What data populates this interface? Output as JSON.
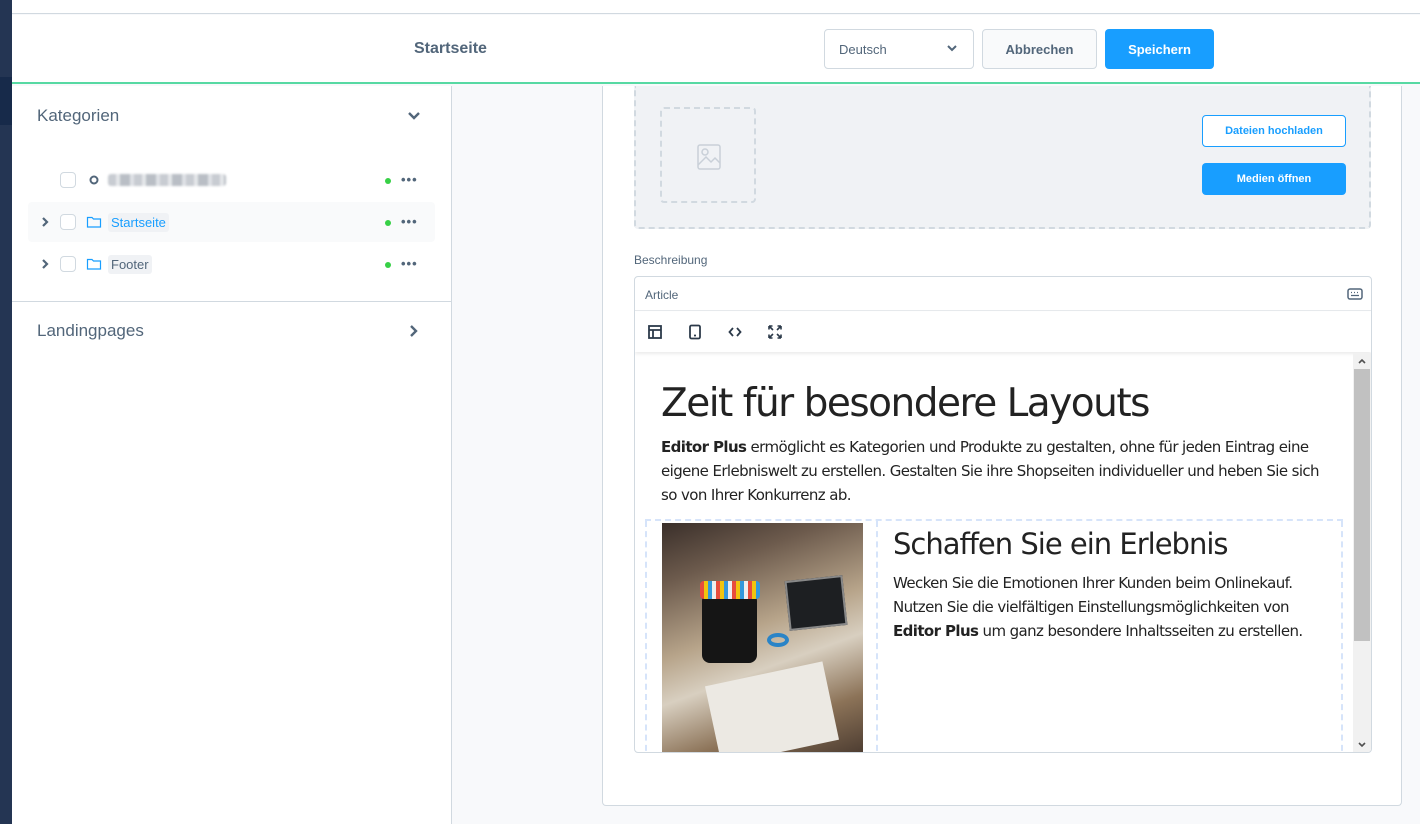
{
  "header": {
    "title": "Startseite",
    "language_select": {
      "value": "Deutsch"
    },
    "cancel_label": "Abbrechen",
    "save_label": "Speichern"
  },
  "sidebar": {
    "sections": [
      {
        "label": "Kategorien",
        "expanded": true
      },
      {
        "label": "Landingpages",
        "expanded": false
      }
    ],
    "tree": [
      {
        "label": "[redacted]",
        "icon": "circle-icon",
        "has_children": false,
        "active": false,
        "status": "active"
      },
      {
        "label": "Startseite",
        "icon": "folder-icon",
        "has_children": true,
        "active": true,
        "status": "active"
      },
      {
        "label": "Footer",
        "icon": "folder-icon",
        "has_children": true,
        "active": false,
        "status": "active"
      }
    ],
    "more_label": "•••"
  },
  "media": {
    "upload_label": "Dateien hochladen",
    "open_media_label": "Medien öffnen"
  },
  "description": {
    "label": "Beschreibung",
    "editor": {
      "mode_label": "Article",
      "toolbar": [
        "layout-icon",
        "mobile-preview-icon",
        "code-icon",
        "fullscreen-icon"
      ],
      "heading": "Zeit für besondere Layouts",
      "intro_bold": "Editor Plus",
      "intro_text": " ermöglicht es Kategorien und Produkte zu gestalten, ohne für jeden Eintrag eine eigene Erlebniswelt zu erstellen. Gestalten Sie ihre Shopseiten individueller und heben Sie sich so von Ihrer Konkurrenz ab.",
      "subheading": "Schaffen Sie ein Erlebnis",
      "body_text_1": "Wecken Sie die Emotionen Ihrer Kunden beim Onlinekauf. Nutzen Sie die vielfältigen Einstellungsmöglichkeiten von ",
      "body_bold": "Editor Plus",
      "body_text_2": " um ganz besondere Inhaltsseiten zu erstellen."
    }
  },
  "colors": {
    "accent": "#189eff",
    "header_border": "#57d9a3",
    "status_active": "#37d046",
    "nav_dark": "#243553"
  }
}
